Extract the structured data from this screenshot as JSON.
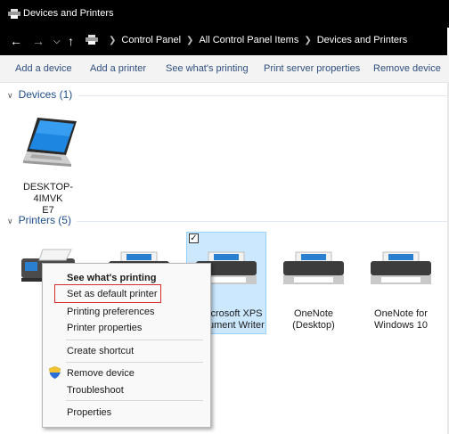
{
  "window": {
    "title": "Devices and Printers"
  },
  "address": {
    "breadcrumbs": [
      "Control Panel",
      "All Control Panel Items",
      "Devices and Printers"
    ]
  },
  "commands": [
    "Add a device",
    "Add a printer",
    "See what's printing",
    "Print server properties",
    "Remove device"
  ],
  "groups": {
    "devices": {
      "label": "Devices (1)"
    },
    "printers": {
      "label": "Printers (5)"
    }
  },
  "devices": [
    {
      "name": "DESKTOP-4IMVK\nE7",
      "icon": "laptop-icon"
    }
  ],
  "printers": [
    {
      "name": "",
      "icon": "fax-icon"
    },
    {
      "name": "",
      "icon": "printer-icon"
    },
    {
      "name": "Microsoft XPS\nDocument Writer",
      "visible_name": "icrosoft XPS\nument Writer",
      "icon": "printer-icon",
      "selected": true
    },
    {
      "name": "OneNote\n(Desktop)",
      "icon": "printer-icon"
    },
    {
      "name": "OneNote for\nWindows 10",
      "icon": "printer-icon"
    }
  ],
  "context_menu": {
    "items": [
      {
        "label": "See what's printing",
        "bold": true
      },
      {
        "label": "Set as default printer",
        "highlighted": true
      },
      {
        "label": "Printing preferences"
      },
      {
        "label": "Printer properties"
      },
      {
        "label": "Create shortcut"
      },
      {
        "label": "Remove device",
        "icon": "shield-icon"
      },
      {
        "label": "Troubleshoot"
      },
      {
        "label": "Properties"
      }
    ]
  },
  "colors": {
    "accent": "#1e4e8c",
    "highlight_box": "#d12b2b",
    "selection": "#cce8ff"
  }
}
